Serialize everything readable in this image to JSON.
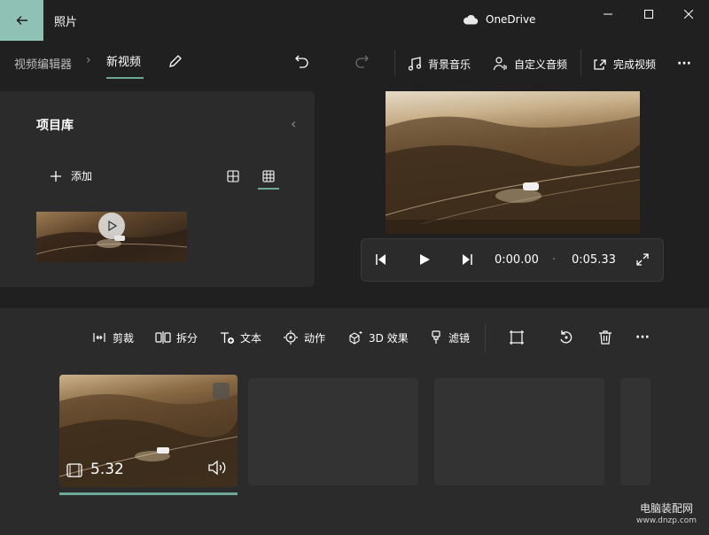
{
  "app": {
    "title": "照片",
    "cloud_label": "OneDrive"
  },
  "breadcrumb": {
    "root": "视频编辑器",
    "separator": "›",
    "current": "新视频"
  },
  "commands": {
    "background_music": "背景音乐",
    "custom_audio": "自定义音频",
    "finish_video": "完成视频",
    "more": "···"
  },
  "library": {
    "title": "项目库",
    "add_label": "添加",
    "collapse_glyph": "‹"
  },
  "player": {
    "current_time": "0:00.00",
    "total_time": "0:05.33",
    "divider": "·"
  },
  "toolbar": {
    "trim": "剪裁",
    "split": "拆分",
    "text": "文本",
    "motion": "动作",
    "effects_3d": "3D 效果",
    "filters": "滤镜",
    "more": "···"
  },
  "storyboard": {
    "clip_duration": "5.32"
  },
  "watermark": {
    "line1": "电脑装配网",
    "line2": "www.dnzp.com"
  },
  "colors": {
    "accent": "#8fc1b4",
    "underline": "#6fa898",
    "bg": "#202020",
    "panel": "#2b2b2b"
  }
}
